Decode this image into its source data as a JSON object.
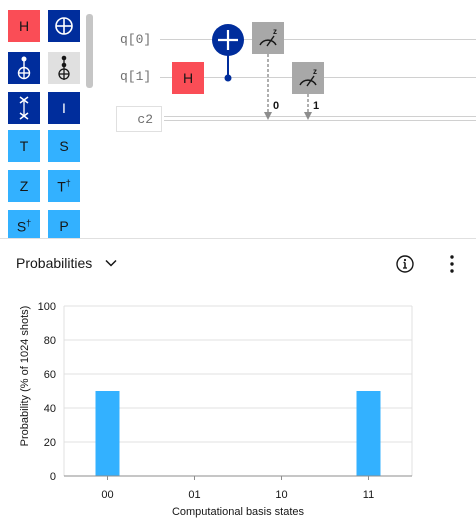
{
  "palette": {
    "gates": [
      {
        "label": "H",
        "style": "red",
        "icon": null,
        "sup": ""
      },
      {
        "label": "",
        "style": "navy",
        "icon": "cnot-target-icon",
        "sup": ""
      },
      {
        "label": "",
        "style": "navy",
        "icon": "cnot-icon",
        "sup": ""
      },
      {
        "label": "",
        "style": "navy",
        "icon": "toffoli-icon",
        "sup": ""
      },
      {
        "label": "",
        "style": "navy",
        "icon": "swap-icon",
        "sup": ""
      },
      {
        "label": "I",
        "style": "navy",
        "icon": null,
        "sup": ""
      },
      {
        "label": "T",
        "style": "blue",
        "icon": null,
        "sup": ""
      },
      {
        "label": "S",
        "style": "blue",
        "icon": null,
        "sup": ""
      },
      {
        "label": "Z",
        "style": "blue",
        "icon": null,
        "sup": ""
      },
      {
        "label": "T",
        "style": "blue",
        "icon": null,
        "sup": "†"
      },
      {
        "label": "S",
        "style": "blue",
        "icon": null,
        "sup": "†"
      },
      {
        "label": "P",
        "style": "blue",
        "icon": null,
        "sup": ""
      }
    ]
  },
  "circuit": {
    "qubits": [
      "q[0]",
      "q[1]"
    ],
    "classical_register": "c2",
    "h_gate_label": "H",
    "measurement_axis": "z",
    "bit_labels": [
      "0",
      "1"
    ]
  },
  "panel": {
    "visualization": "Probabilities"
  },
  "chart_data": {
    "type": "bar",
    "categories": [
      "00",
      "01",
      "10",
      "11"
    ],
    "values": [
      50,
      0,
      0,
      50
    ],
    "xlabel": "Computational basis states",
    "ylabel": "Probability (% of 1024 shots)",
    "ylim": [
      0,
      100
    ],
    "yticks": [
      0,
      20,
      40,
      60,
      80,
      100
    ],
    "grid": true,
    "bar_color": "#33b1ff"
  },
  "colors": {
    "h_gate": "#fa4d56",
    "cnot": "#002d9c",
    "phase_gates": "#33b1ff",
    "measure": "#a8a8a8"
  }
}
